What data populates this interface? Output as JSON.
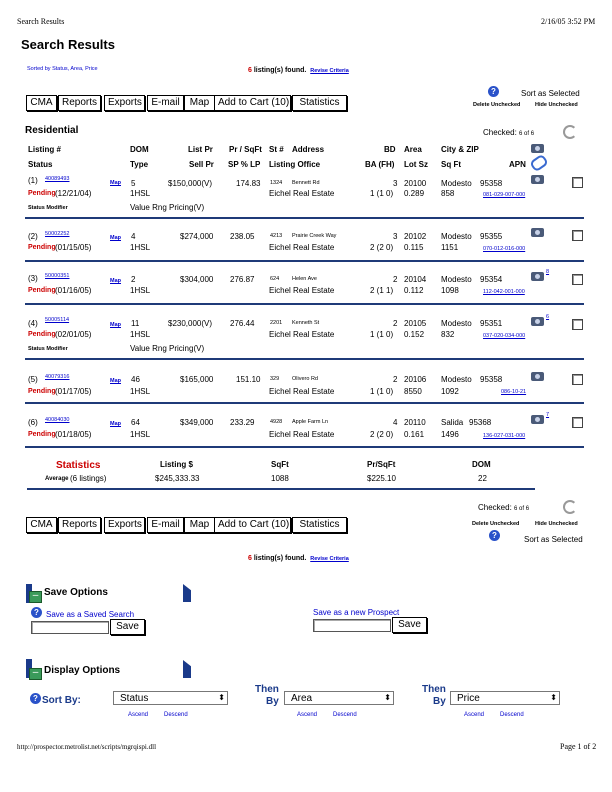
{
  "print_header": {
    "title": "Search Results",
    "datetime": "2/16/05 3:52 PM"
  },
  "page_title": "Search Results",
  "sorted_by": "Sorted by Status, Area, Price",
  "found": {
    "count": "6",
    "text": "listing(s) found.",
    "revise": "Revise Criteria"
  },
  "sort_as_selected": "Sort as Selected",
  "delete_unchecked": "Delete Unchecked",
  "hide_unchecked": "Hide Unchecked",
  "toolbar": {
    "cma": "CMA",
    "reports": "Reports",
    "exports": "Exports",
    "email": "E-mail",
    "map": "Map",
    "cart": "Add to Cart (10)",
    "statistics": "Statistics"
  },
  "section": "Residential",
  "checked": {
    "label": "Checked:",
    "count": "6 of 6"
  },
  "headers": {
    "listing": "Listing #",
    "dom": "DOM",
    "list_pr": "List Pr",
    "pr_sqft": "Pr / SqFt",
    "st": "St #",
    "address": "Address",
    "bd": "BD",
    "area": "Area",
    "city_zip": "City & ZIP",
    "status": "Status",
    "type": "Type",
    "sell_pr": "Sell Pr",
    "sp_lp": "SP % LP",
    "office": "Listing Office",
    "ba": "BA (FH)",
    "lot": "Lot Sz",
    "sqft": "Sq Ft",
    "apn": "APN"
  },
  "listings": [
    {
      "idx": "(1)",
      "num": "40089493",
      "map": "Map",
      "dom": "5",
      "price": "$150,000(V)",
      "ppsf": "174.83",
      "st": "1324",
      "street": "Bennett Rd",
      "bd": "3",
      "area": "20100",
      "city": "Modesto",
      "zip": "95358",
      "status": "Pending",
      "date": "(12/21/04)",
      "type": "1HSL",
      "office": "Eichel Real Estate",
      "ba": "1 (1 0)",
      "lot": "0.289",
      "sqft": "858",
      "apn": "081-029-007-000",
      "photos": "",
      "modifier_label": "Status Modifier",
      "modifier": "Value Rng Pricing(V)"
    },
    {
      "idx": "(2)",
      "num": "50002252",
      "map": "Map",
      "dom": "4",
      "price": "$274,000",
      "ppsf": "238.05",
      "st": "4213",
      "street": "Prairie Creek Way",
      "bd": "3",
      "area": "20102",
      "city": "Modesto",
      "zip": "95355",
      "status": "Pending",
      "date": "(01/15/05)",
      "type": "1HSL",
      "office": "Eichel Real Estate",
      "ba": "2 (2 0)",
      "lot": "0.115",
      "sqft": "1151",
      "apn": "070-012-016-000",
      "photos": "",
      "modifier_label": "",
      "modifier": ""
    },
    {
      "idx": "(3)",
      "num": "50000351",
      "map": "Map",
      "dom": "2",
      "price": "$304,000",
      "ppsf": "276.87",
      "st": "624",
      "street": "Helen Ave",
      "bd": "2",
      "area": "20104",
      "city": "Modesto",
      "zip": "95354",
      "status": "Pending",
      "date": "(01/16/05)",
      "type": "1HSL",
      "office": "Eichel Real Estate",
      "ba": "2 (1 1)",
      "lot": "0.112",
      "sqft": "1098",
      "apn": "112-042-001-000",
      "photos": "8",
      "modifier_label": "",
      "modifier": ""
    },
    {
      "idx": "(4)",
      "num": "50005114",
      "map": "Map",
      "dom": "11",
      "price": "$230,000(V)",
      "ppsf": "276.44",
      "st": "2201",
      "street": "Kenneth St",
      "bd": "2",
      "area": "20105",
      "city": "Modesto",
      "zip": "95351",
      "status": "Pending",
      "date": "(02/01/05)",
      "type": "1HSL",
      "office": "Eichel Real Estate",
      "ba": "1 (1 0)",
      "lot": "0.152",
      "sqft": "832",
      "apn": "037-020-034-000",
      "photos": "6",
      "modifier_label": "Status Modifier",
      "modifier": "Value Rng Pricing(V)"
    },
    {
      "idx": "(5)",
      "num": "40079316",
      "map": "Map",
      "dom": "46",
      "price": "$165,000",
      "ppsf": "151.10",
      "st": "329",
      "street": "Olivero Rd",
      "bd": "2",
      "area": "20106",
      "city": "Modesto",
      "zip": "95358",
      "status": "Pending",
      "date": "(01/17/05)",
      "type": "1HSL",
      "office": "Eichel Real Estate",
      "ba": "1 (1 0)",
      "lot": "8550",
      "sqft": "1092",
      "apn": "086-10-21",
      "photos": "",
      "modifier_label": "",
      "modifier": ""
    },
    {
      "idx": "(6)",
      "num": "40084030",
      "map": "Map",
      "dom": "64",
      "price": "$349,000",
      "ppsf": "233.29",
      "st": "4928",
      "street": "Apple Farm Ln",
      "bd": "4",
      "area": "20110",
      "city": "Salida",
      "zip": "95368",
      "status": "Pending",
      "date": "(01/18/05)",
      "type": "1HSL",
      "office": "Eichel Real Estate",
      "ba": "2 (2 0)",
      "lot": "0.161",
      "sqft": "1496",
      "apn": "136-027-031-000",
      "photos": "7",
      "modifier_label": "",
      "modifier": ""
    }
  ],
  "stats": {
    "title": "Statistics",
    "average": "Average",
    "count": "(6 listings)",
    "listing_label": "Listing $",
    "listing_val": "$245,333.33",
    "sqft_label": "SqFt",
    "sqft_val": "1088",
    "prsqft_label": "Pr/SqFt",
    "prsqft_val": "$225.10",
    "dom_label": "DOM",
    "dom_val": "22"
  },
  "save_options": {
    "title": "Save Options",
    "saved_search": "Save as a Saved Search",
    "new_prospect": "Save as a new Prospect",
    "save": "Save"
  },
  "display_options": {
    "title": "Display Options",
    "sort_by": "Sort By:",
    "then": "Then",
    "by": "By",
    "sort1": "Status",
    "sort2": "Area",
    "sort3": "Price",
    "ascend": "Ascend",
    "descend": "Descend"
  },
  "footer": {
    "url": "http://prospector.metrolist.net/scripts/mgrqispi.dll",
    "page": "Page 1 of 2"
  }
}
